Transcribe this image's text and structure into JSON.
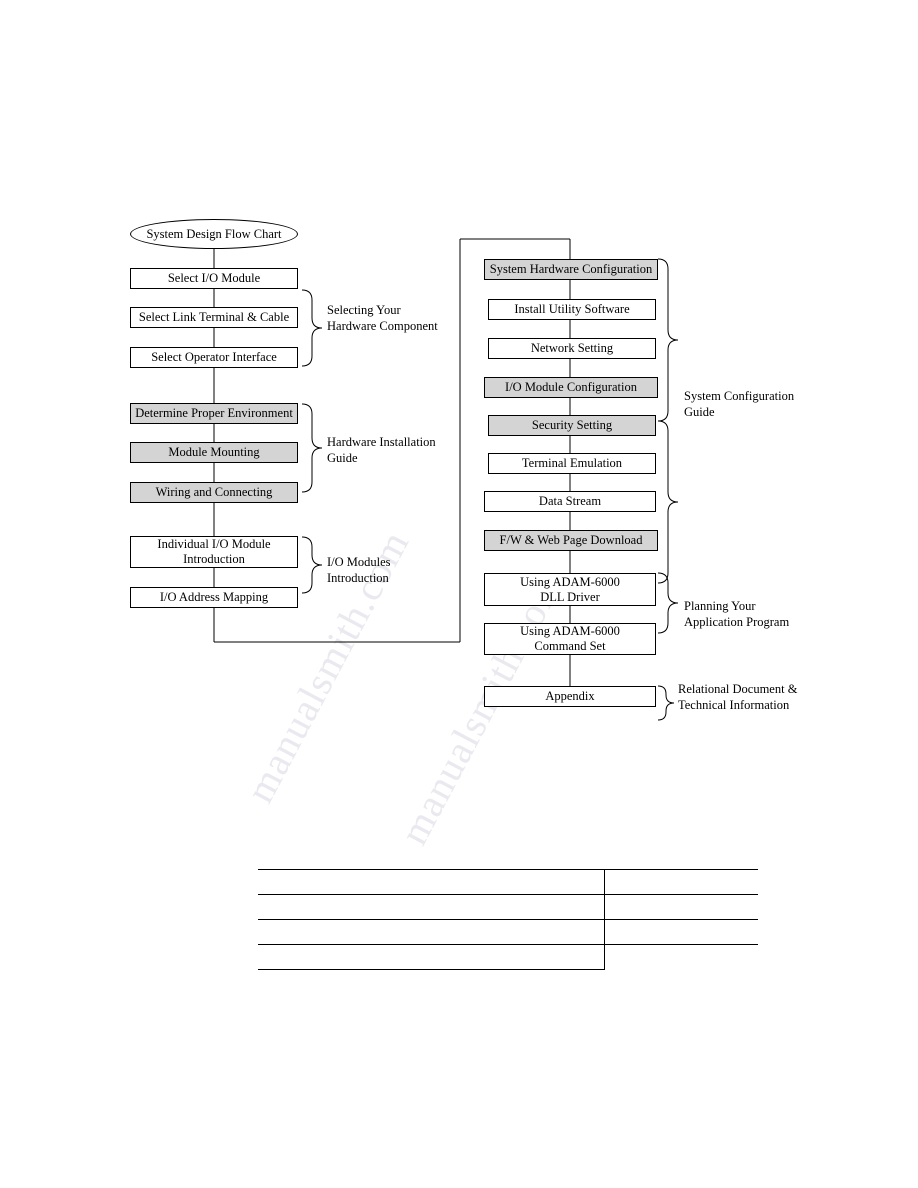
{
  "diagram": {
    "title_node": "System Design Flow Chart",
    "left_column": [
      {
        "label": "Select I/O Module",
        "shaded": false
      },
      {
        "label": "Select Link Terminal & Cable",
        "shaded": false
      },
      {
        "label": "Select Operator Interface",
        "shaded": false
      },
      {
        "label": "Determine Proper Environment",
        "shaded": true
      },
      {
        "label": "Module Mounting",
        "shaded": true
      },
      {
        "label": "Wiring and Connecting",
        "shaded": true
      },
      {
        "label": "Individual I/O Module\nIntroduction",
        "shaded": false
      },
      {
        "label": "I/O Address Mapping",
        "shaded": false
      }
    ],
    "left_groups": [
      {
        "label": "Selecting Your\nHardware Component"
      },
      {
        "label": "Hardware Installation\nGuide"
      },
      {
        "label": "I/O Modules\nIntroduction"
      }
    ],
    "right_column": [
      {
        "label": "System Hardware Configuration",
        "shaded": true
      },
      {
        "label": "Install Utility Software",
        "shaded": false
      },
      {
        "label": "Network Setting",
        "shaded": false
      },
      {
        "label": "I/O Module Configuration",
        "shaded": true
      },
      {
        "label": "Security Setting",
        "shaded": true
      },
      {
        "label": "Terminal Emulation",
        "shaded": false
      },
      {
        "label": "Data Stream",
        "shaded": false
      },
      {
        "label": "F/W & Web Page Download",
        "shaded": true
      },
      {
        "label": "Using ADAM-6000\nDLL Driver",
        "shaded": false
      },
      {
        "label": "Using ADAM-6000\nCommand Set",
        "shaded": false
      },
      {
        "label": "Appendix",
        "shaded": false
      }
    ],
    "right_groups": [
      {
        "label": "System Configuration\nGuide"
      },
      {
        "label": "Planning Your\nApplication Program"
      },
      {
        "label": "Relational Document &\nTechnical Information"
      }
    ]
  },
  "watermark": {
    "line1": "manualsmith.com",
    "line2": "manualsmith.com"
  },
  "bottom_table": {
    "rows": [
      {
        "left": "",
        "right": ""
      },
      {
        "left": "",
        "right": ""
      },
      {
        "left": "",
        "right": ""
      },
      {
        "left": "",
        "right": ""
      }
    ]
  }
}
